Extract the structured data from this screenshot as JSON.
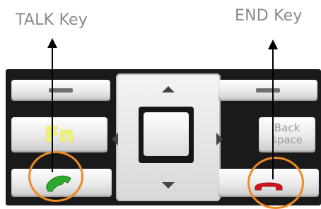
{
  "callouts": {
    "talk_label": "TALK Key",
    "end_label": "END Key"
  },
  "keys": {
    "fn_label": "Fn",
    "backspace_label": "Back\nspace"
  },
  "icons": {
    "talk": "green-phone-handset-icon",
    "end": "red-phone-handset-icon",
    "dpad_up": "up-arrow-icon",
    "dpad_down": "down-arrow-icon",
    "dpad_left": "left-arrow-icon",
    "dpad_right": "right-arrow-icon"
  },
  "colors": {
    "callout_text": "#8a8a8a",
    "highlight_circle": "#f08a24",
    "talk_green": "#2fa82f",
    "end_red": "#d0161b",
    "fn_yellow": "#f2f26a"
  }
}
